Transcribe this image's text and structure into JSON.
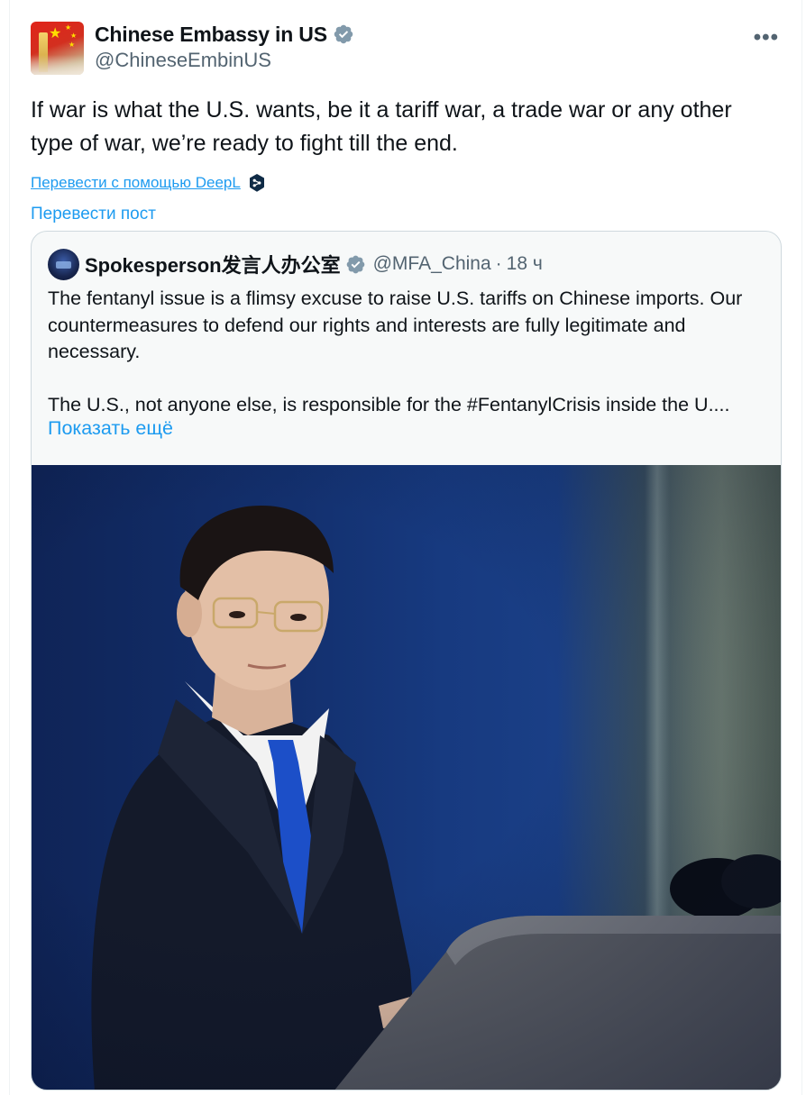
{
  "author": {
    "display_name": "Chinese Embassy in US",
    "handle": "@ChineseEmbinUS",
    "avatar_icon": "flag-tiananmen-avatar",
    "verified_icon": "verified-badge-icon"
  },
  "menu": {
    "more_label": "•••"
  },
  "tweet": {
    "text": "If war is what the U.S. wants, be it a tariff war, a trade war or any other type of war, we’re ready to fight till the end."
  },
  "translation": {
    "deepl_label": "Перевести с помощью DeepL",
    "translate_post_label": "Перевести пост"
  },
  "quote": {
    "display_name": "Spokesperson发言人办公室",
    "handle": "@MFA_China",
    "separator": "·",
    "time": "18 ч",
    "paragraph_1": "The fentanyl issue is a flimsy excuse to raise U.S. tariffs on Chinese imports. Our countermeasures to defend our rights and interests are fully legitimate and necessary.",
    "paragraph_2": "The U.S., not anyone else, is responsible for the #FentanylCrisis inside the U....",
    "show_more_label": "Показать ещё",
    "photo_description_icon": "press-conference-photo"
  },
  "colors": {
    "link": "#1d9bf0",
    "verified_badge": "#829aab",
    "text_primary": "#0f1419",
    "text_secondary": "#536471",
    "deepl_blue": "#0f2b46"
  }
}
